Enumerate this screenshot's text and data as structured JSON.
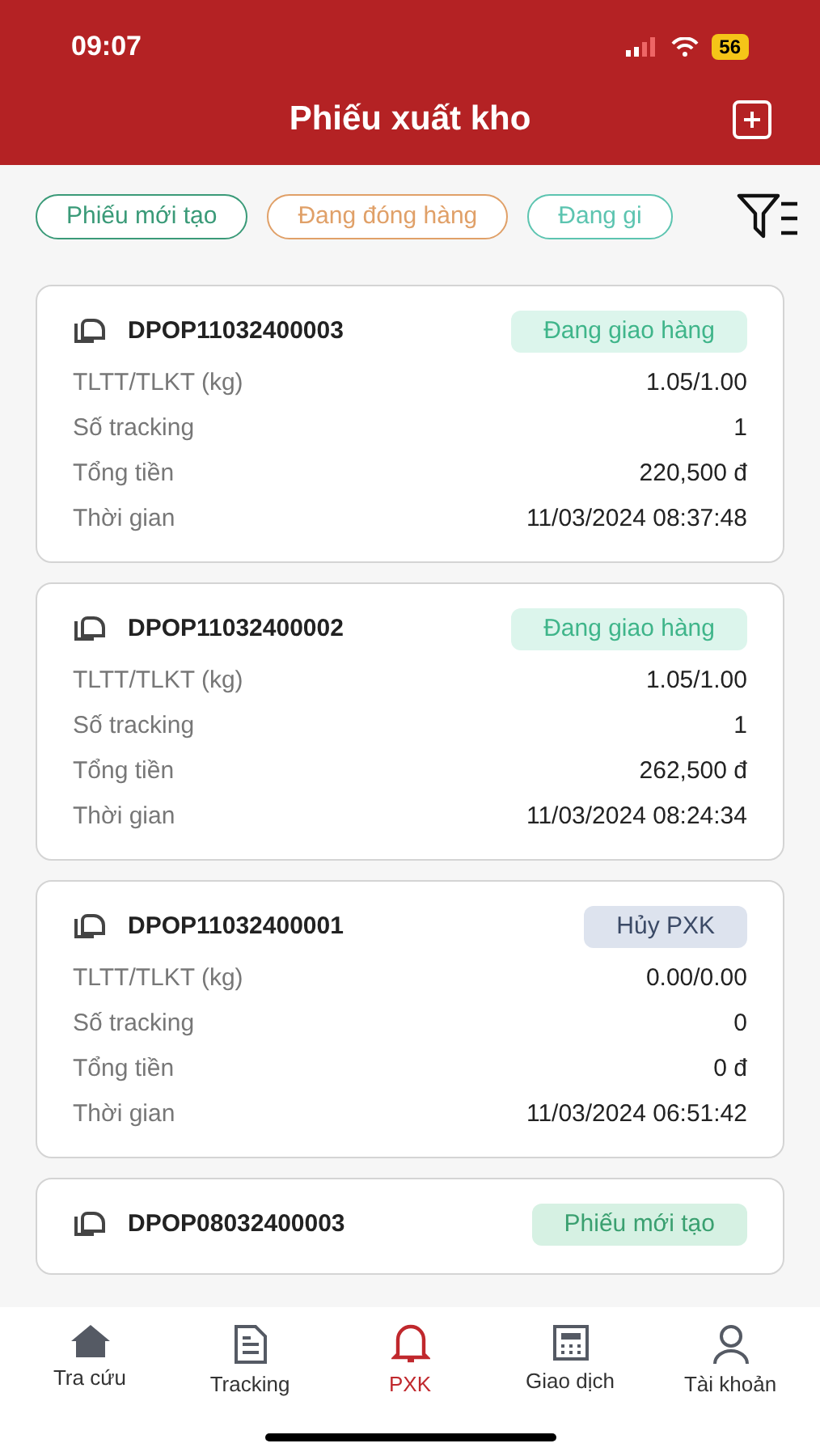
{
  "status_bar": {
    "time": "09:07",
    "battery": "56"
  },
  "header": {
    "title": "Phiếu xuất kho"
  },
  "filters": [
    {
      "label": "Phiếu mới tạo",
      "color": "#3a9a78"
    },
    {
      "label": "Đang đóng hàng",
      "color": "#e0a068"
    },
    {
      "label": "Đang gi",
      "color": "#5cc4b0"
    }
  ],
  "orders": [
    {
      "code": "DPOP11032400003",
      "status": {
        "label": "Đang giao hàng",
        "kind": "delivering"
      },
      "fields": [
        {
          "label": "TLTT/TLKT (kg)",
          "value": "1.05/1.00"
        },
        {
          "label": "Số tracking",
          "value": "1"
        },
        {
          "label": "Tổng tiền",
          "value": "220,500 đ"
        },
        {
          "label": "Thời gian",
          "value": "11/03/2024 08:37:48"
        }
      ]
    },
    {
      "code": "DPOP11032400002",
      "status": {
        "label": "Đang giao hàng",
        "kind": "delivering"
      },
      "fields": [
        {
          "label": "TLTT/TLKT (kg)",
          "value": "1.05/1.00"
        },
        {
          "label": "Số tracking",
          "value": "1"
        },
        {
          "label": "Tổng tiền",
          "value": "262,500 đ"
        },
        {
          "label": "Thời gian",
          "value": "11/03/2024 08:24:34"
        }
      ]
    },
    {
      "code": "DPOP11032400001",
      "status": {
        "label": "Hủy PXK",
        "kind": "cancelled"
      },
      "fields": [
        {
          "label": "TLTT/TLKT (kg)",
          "value": "0.00/0.00"
        },
        {
          "label": "Số tracking",
          "value": "0"
        },
        {
          "label": "Tổng tiền",
          "value": "0 đ"
        },
        {
          "label": "Thời gian",
          "value": "11/03/2024 06:51:42"
        }
      ]
    },
    {
      "code": "DPOP08032400003",
      "status": {
        "label": "Phiếu mới tạo",
        "kind": "new"
      }
    }
  ],
  "nav": [
    {
      "label": "Tra cứu",
      "selected": false
    },
    {
      "label": "Tracking",
      "selected": false
    },
    {
      "label": "PXK",
      "selected": true
    },
    {
      "label": "Giao dịch",
      "selected": false
    },
    {
      "label": "Tài khoản",
      "selected": false
    }
  ]
}
